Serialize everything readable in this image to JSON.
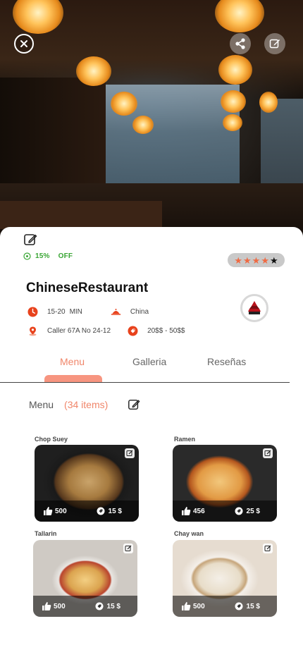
{
  "restaurant": {
    "name": "ChineseRestaurant",
    "discount": "15%",
    "discount_label": "OFF",
    "rating": 4,
    "rating_max": 5,
    "time": "15-20",
    "time_unit": "MIN",
    "cuisine": "China",
    "address": "Caller 67A  No 24-12",
    "price_range": "20$$ - 50$$",
    "logo_text": "CHINESE"
  },
  "tabs": [
    {
      "label": "Menu",
      "active": true
    },
    {
      "label": "Galleria",
      "active": false
    },
    {
      "label": "Reseñas",
      "active": false
    }
  ],
  "menu": {
    "title": "Menu",
    "count": "(34  items)",
    "items": [
      {
        "name": "Chop Suey",
        "likes": "500",
        "price": "15 $"
      },
      {
        "name": "Ramen",
        "likes": "456",
        "price": "25 $"
      },
      {
        "name": "Tallarin",
        "likes": "500",
        "price": "15 $"
      },
      {
        "name": "Chay wan",
        "likes": "500",
        "price": "15 $"
      }
    ]
  },
  "colors": {
    "accent": "#f0866a",
    "discount_green": "#3aa635",
    "icon_red": "#e8421c"
  },
  "icons": {
    "close": "close-icon",
    "share": "share-icon",
    "edit": "edit-icon",
    "like": "thumbs-up-icon",
    "price": "price-tag-icon"
  }
}
